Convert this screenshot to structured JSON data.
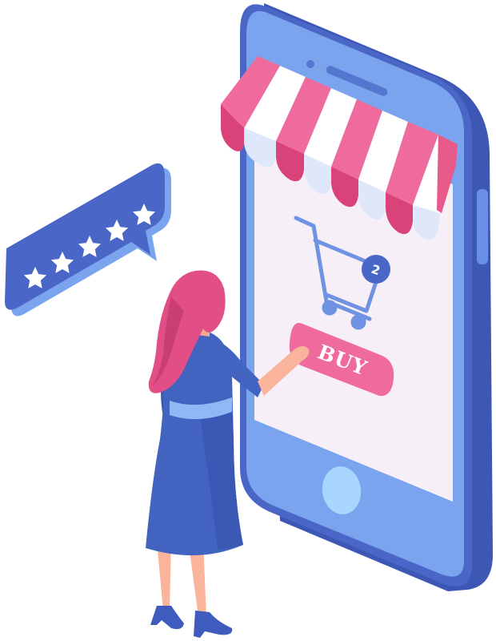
{
  "buy_button": {
    "label": "BUY"
  },
  "cart": {
    "badge_count": "2",
    "icon": "shopping-cart-icon"
  },
  "rating": {
    "stars": 5,
    "max_stars": 5,
    "icon": "star-icon"
  },
  "colors": {
    "phone_body": "#4a67c8",
    "phone_face": "#7aa5ee",
    "screen": "#f7eff8",
    "awning_pink": "#f06b9d",
    "awning_white": "#ffffff",
    "button_pink": "#f06b9d",
    "cart_line": "#6f93e2",
    "badge": "#4a67c8",
    "bubble": "#4a67c8",
    "hair": "#e24f86",
    "dress": "#4263c0",
    "skin": "#f9b49b"
  }
}
